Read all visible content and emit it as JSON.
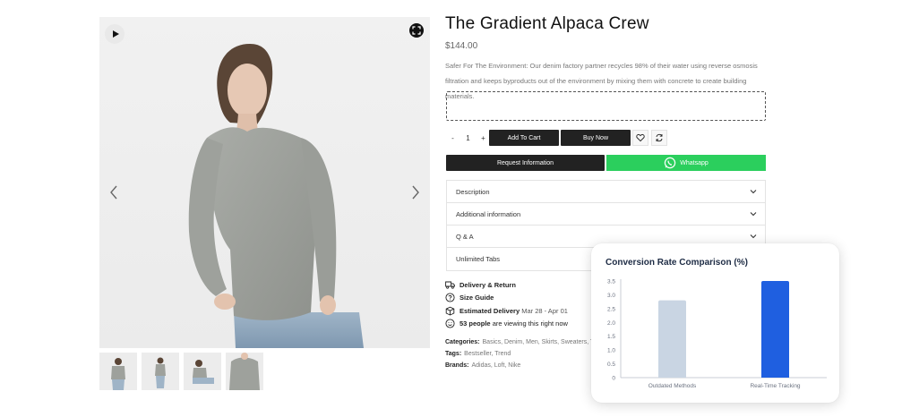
{
  "product": {
    "title": "The Gradient Alpaca Crew",
    "price": "$144.00",
    "description": "Safer For The Environment: Our denim factory partner recycles 98% of their water using reverse osmosis filtration and keeps byproducts out of the environment by mixing them with concrete to create building materials.",
    "quantity": "1"
  },
  "actions": {
    "minus": "-",
    "plus": "+",
    "add_to_cart": "Add To Cart",
    "buy_now": "Buy Now",
    "request_information": "Request Information",
    "whatsapp": "Whatsapp"
  },
  "accordion": [
    "Description",
    "Additional information",
    "Q & A",
    "Unlimited Tabs"
  ],
  "meta": {
    "delivery_return": "Delivery & Return",
    "size_guide": "Size Guide",
    "estimated_delivery_label": "Estimated Delivery",
    "estimated_delivery_value": "Mar 28 - Apr 01",
    "viewers_count": "53 people",
    "viewers_suffix": "are viewing this right now"
  },
  "taxonomy": {
    "categories_label": "Categories:",
    "categories_value": "Basics, Denim, Men, Skirts, Sweaters, T",
    "tags_label": "Tags:",
    "tags_value": "Bestseller, Trend",
    "brands_label": "Brands:",
    "brands_value": "Adidas, Loft, Nike"
  },
  "icons": [
    "play-icon",
    "zoom-icon",
    "chevron-left-icon",
    "chevron-right-icon",
    "heart-icon",
    "compare-icon",
    "whatsapp-icon",
    "chevron-down-icon",
    "truck-icon",
    "question-icon",
    "box-icon",
    "smiley-icon"
  ],
  "colors": {
    "dark_button": "#222222",
    "whatsapp_green": "#2bcf5d",
    "bar_outdated": "#c9d5e3",
    "bar_realtime": "#1f5fe0"
  },
  "chart_data": {
    "type": "bar",
    "title": "Conversion Rate Comparison (%)",
    "categories": [
      "Outdated Methods",
      "Real-Time Tracking"
    ],
    "values": [
      2.8,
      3.5
    ],
    "ylim": [
      0,
      3.5
    ],
    "yticks": [
      "0",
      "0.5",
      "1.0",
      "1.5",
      "2.0",
      "2.5",
      "3.0",
      "3.5"
    ],
    "bar_colors": [
      "#c9d5e3",
      "#1f5fe0"
    ],
    "grid": false
  }
}
